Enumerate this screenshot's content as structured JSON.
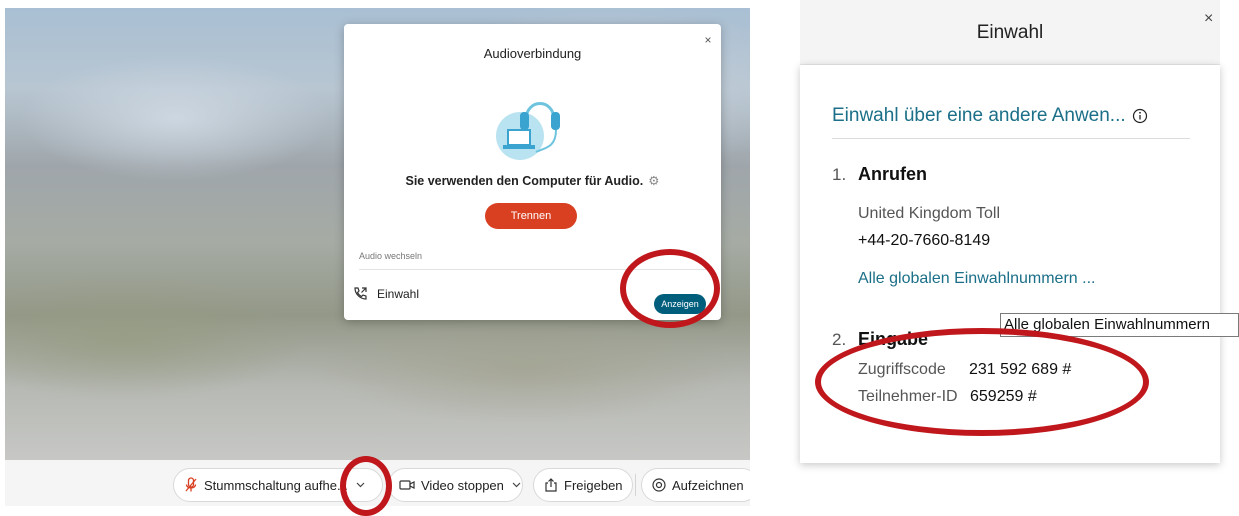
{
  "audio_dialog": {
    "title": "Audioverbindung",
    "close_glyph": "×",
    "message": "Sie verwenden den Computer für Audio.",
    "disconnect_label": "Trennen",
    "switch_audio_label": "Audio wechseln",
    "dial_in_label": "Einwahl",
    "show_label": "Anzeigen",
    "icons": [
      "headset-laptop-illustration",
      "gear-icon",
      "phone-icon",
      "close-icon"
    ]
  },
  "toolbar": {
    "mute_label": "Stummschaltung aufhe...",
    "video_label": "Video stoppen",
    "share_label": "Freigeben",
    "record_label": "Aufzeichnen",
    "icons": [
      "microphone-muted-icon",
      "chevron-down-icon",
      "video-camera-icon",
      "share-icon",
      "record-icon"
    ]
  },
  "dial_in_panel": {
    "title": "Einwahl",
    "close_glyph": "×",
    "alternate_app_link": "Einwahl über eine andere Anwen...",
    "step1": {
      "number": "1.",
      "title": "Anrufen",
      "country": "United Kingdom Toll",
      "phone": "+44-20-7660-8149",
      "global_numbers_link": "Alle globalen Einwahlnummern ..."
    },
    "step2": {
      "number": "2.",
      "title": "Eingabe",
      "access_code_label": "Zugriffscode",
      "access_code": "231 592 689 #",
      "attendee_id_label": "Teilnehmer-ID",
      "attendee_id": "659259 #"
    },
    "tooltip": "Alle globalen Einwahlnummern"
  },
  "colors": {
    "accent_link": "#1b6f88",
    "disconnect_button": "#d93f21",
    "show_button": "#005e7d",
    "highlight_ring": "#c0171c"
  }
}
